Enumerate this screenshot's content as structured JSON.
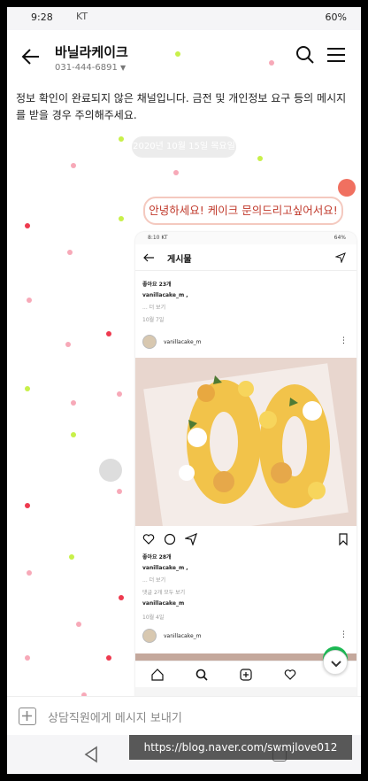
{
  "status_bar": {
    "time": "9:28",
    "carrier": "KT",
    "battery": "60%"
  },
  "header": {
    "title": "바닐라케이크",
    "phone": "031-444-6891"
  },
  "chat": {
    "notice": "정보 확인이 완료되지 않은 채널입니다. 금전 및 개인정보 요구 등의 메시지를 받을 경우 주의해주세요.",
    "date_label": "2020년 10월 15일 목요일",
    "message": "안녕하세요! 케이크 문의드리고싶어서요!"
  },
  "embedded_post": {
    "status_time": "8:10 KT",
    "status_battery": "64%",
    "header_title": "게시물",
    "likes_top": "좋아요 23개",
    "account_top": "vanillacake_m ,",
    "more_top": "... 더 보기",
    "date_top": "10월 7일",
    "account_name": "vanillacake_m",
    "likes": "좋아요 28개",
    "caption_account": "vanillacake_m ,",
    "more": "... 더 보기",
    "comments_link": "댓글 2개 모두 보기",
    "comment_account": "vanillacake_m",
    "post_date": "10월 4일",
    "account_name_2": "vanillacake_m"
  },
  "input": {
    "placeholder": "상담직원에게 메시지 보내기"
  },
  "watermark": {
    "text": "https://blog.naver.com/swmjlove012"
  },
  "colors": {
    "accent_red": "#c0392b",
    "bubble_border": "#f4c9bf",
    "dot_pink": "#f7a9b8",
    "dot_red": "#ee3a4f",
    "dot_lime": "#c8f04a"
  }
}
